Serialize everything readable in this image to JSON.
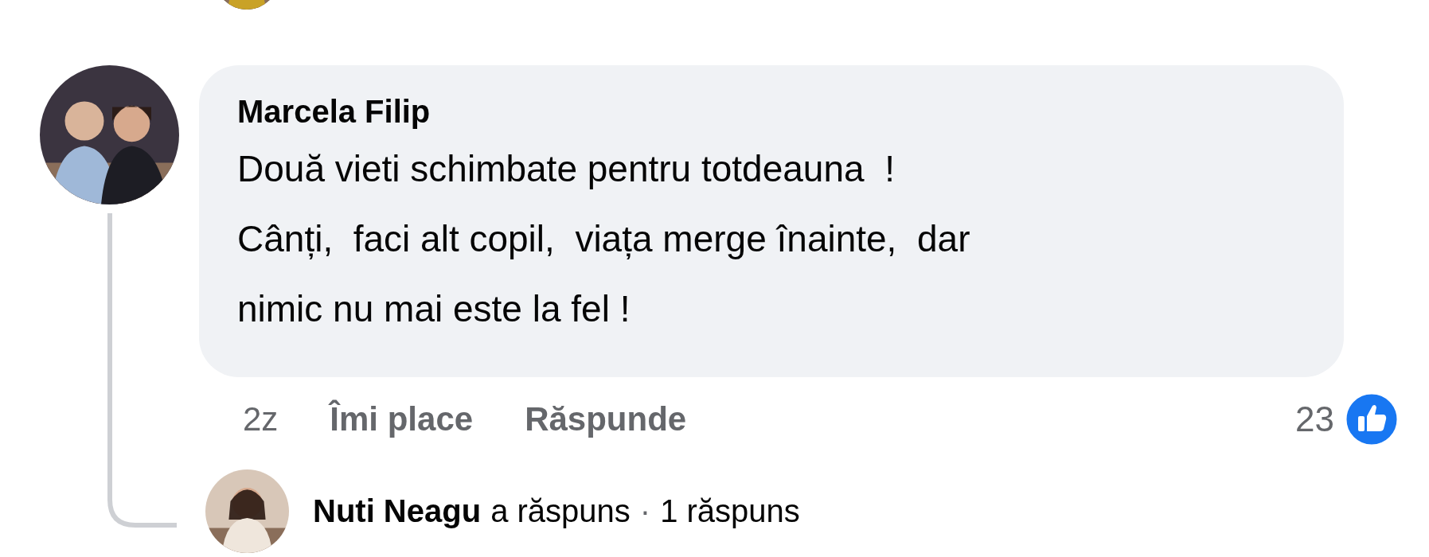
{
  "comment": {
    "author": "Marcela Filip",
    "text": "Două vieti schimbate pentru totdeauna  !\nCânți,  faci alt copil,  viața merge înainte,  dar\nnimic nu mai este la fel !",
    "time": "2z",
    "actions": [
      "Îmi place",
      "Răspunde"
    ],
    "reaction_count": "23"
  },
  "reply_summary": {
    "author": "Nuti Neagu",
    "action": "a răspuns",
    "separator": "·",
    "count": "1 răspuns"
  }
}
